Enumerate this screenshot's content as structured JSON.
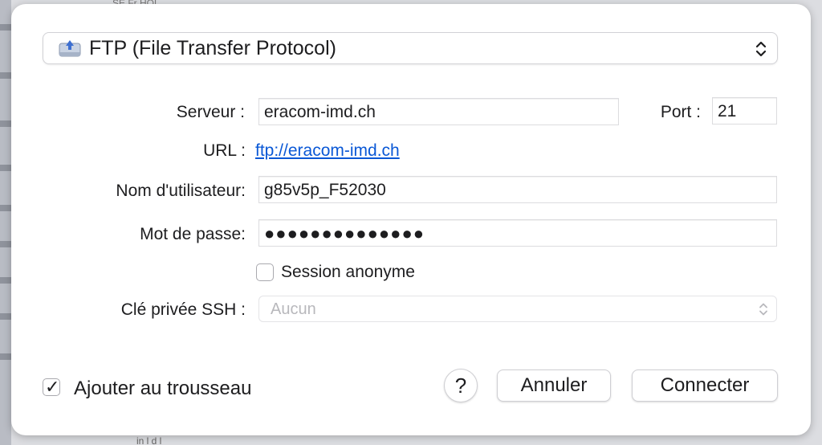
{
  "background": {
    "top_fragment": "SE  Fr  HOL",
    "bottom_fragment": "in  l  d  l"
  },
  "protocol": {
    "label": "FTP (File Transfer Protocol)",
    "icon": "ftp-drive-icon"
  },
  "server": {
    "label": "Serveur :",
    "value": "eracom-imd.ch"
  },
  "port": {
    "label": "Port :",
    "value": "21"
  },
  "url": {
    "label": "URL :",
    "value": "ftp://eracom-imd.ch"
  },
  "username": {
    "label": "Nom d'utilisateur:",
    "value": "g85v5p_F52030"
  },
  "password": {
    "label": "Mot de passe:",
    "value": "●●●●●●●●●●●●●●"
  },
  "anonymous": {
    "label": "Session anonyme",
    "checked": false
  },
  "ssh_key": {
    "label": "Clé privée SSH :",
    "value": "Aucun"
  },
  "keychain": {
    "label": "Ajouter au trousseau",
    "checked": true,
    "mark": "✓"
  },
  "buttons": {
    "help": "?",
    "cancel": "Annuler",
    "connect": "Connecter"
  },
  "colors": {
    "link": "#0a58d6",
    "disabled_text": "#b8b8bc"
  }
}
